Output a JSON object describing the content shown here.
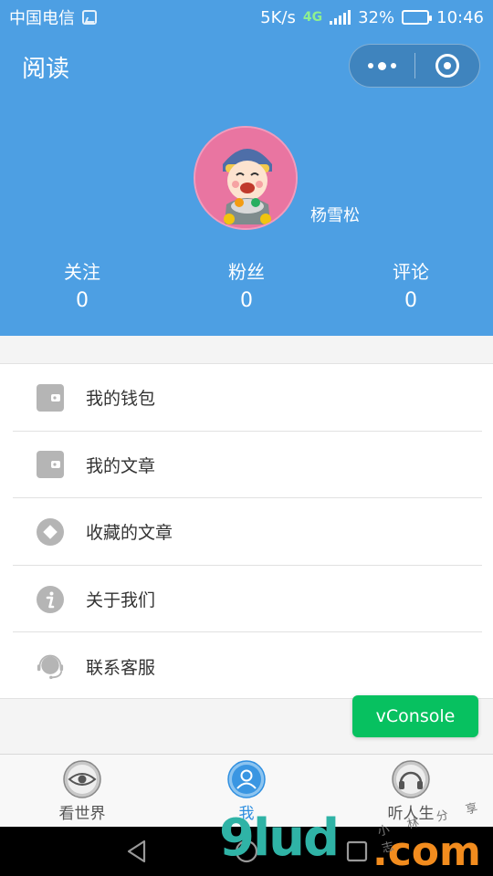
{
  "status_bar": {
    "carrier": "中国电信",
    "speed": "5K/s",
    "network": "4G",
    "battery_percent": "32%",
    "battery_level": 0.32,
    "time": "10:46"
  },
  "nav": {
    "title": "阅读",
    "more_icon": "more-dots-icon",
    "close_icon": "target-circle-icon"
  },
  "profile": {
    "username": "杨雪松",
    "stats": [
      {
        "label": "关注",
        "value": "0"
      },
      {
        "label": "粉丝",
        "value": "0"
      },
      {
        "label": "评论",
        "value": "0"
      }
    ]
  },
  "menu": {
    "items": [
      {
        "label": "我的钱包",
        "icon": "wallet-icon"
      },
      {
        "label": "我的文章",
        "icon": "wallet-icon"
      },
      {
        "label": "收藏的文章",
        "icon": "diamond-icon"
      },
      {
        "label": "关于我们",
        "icon": "info-icon"
      },
      {
        "label": "联系客服",
        "icon": "headset-icon"
      }
    ]
  },
  "vconsole": {
    "label": "vConsole"
  },
  "tabbar": {
    "tabs": [
      {
        "label": "看世界",
        "icon": "eye-icon",
        "active": false
      },
      {
        "label": "我",
        "icon": "user-icon",
        "active": true
      },
      {
        "label": "听人生",
        "icon": "headphones-icon",
        "active": false
      }
    ]
  },
  "colors": {
    "primary": "#4d9fe3",
    "tab_active": "#2f8fe0",
    "tab_inactive": "#555555",
    "vconsole": "#07c160",
    "icon_gray": "#b5b5b5"
  },
  "watermark": {
    "main": "9lud",
    "suffix": ".com",
    "small": "小 林 分 享 志"
  }
}
